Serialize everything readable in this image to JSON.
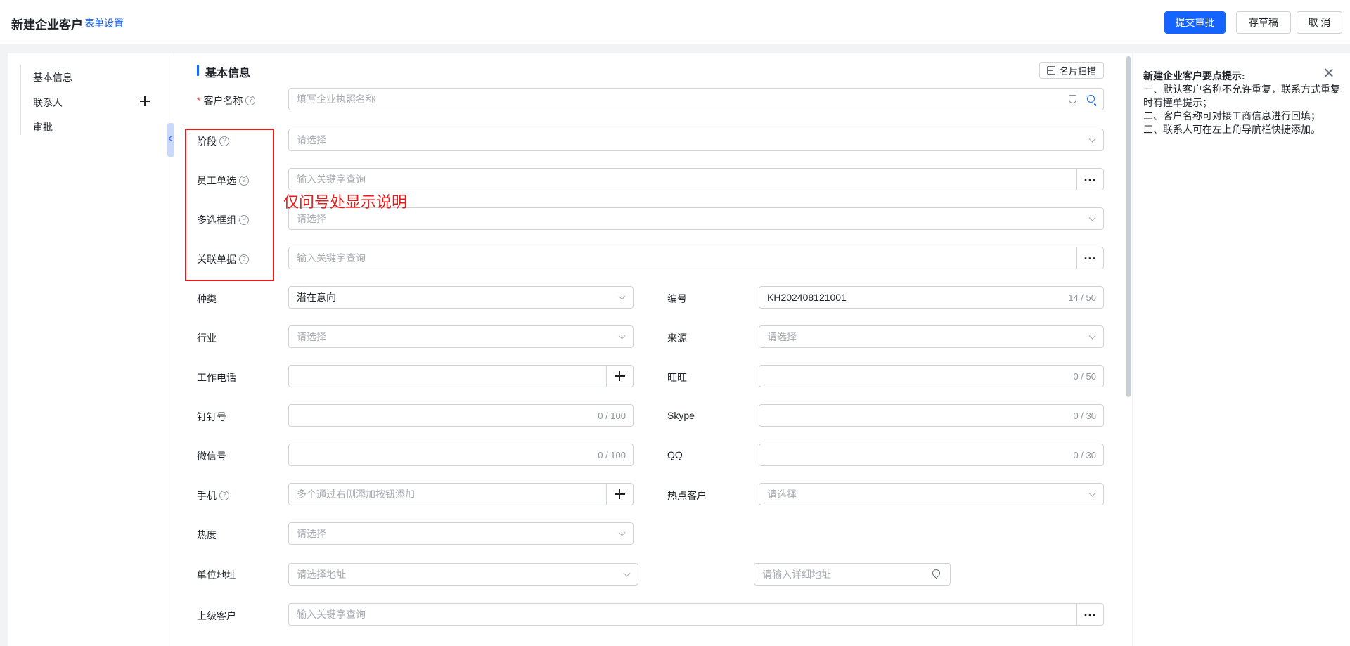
{
  "header": {
    "title": "新建企业客户",
    "form_settings": "表单设置",
    "submit": "提交审批",
    "draft": "存草稿",
    "cancel": "取 消"
  },
  "nav": {
    "items": [
      "基本信息",
      "联系人",
      "审批"
    ]
  },
  "section": {
    "title": "基本信息",
    "scan": "名片扫描"
  },
  "fields": {
    "customer_name": {
      "label": "客户名称",
      "placeholder": "填写企业执照名称"
    },
    "stage": {
      "label": "阶段",
      "placeholder": "请选择"
    },
    "employee": {
      "label": "员工单选",
      "placeholder": "输入关键字查询"
    },
    "multi": {
      "label": "多选框组",
      "placeholder": "请选择"
    },
    "related": {
      "label": "关联单据",
      "placeholder": "输入关键字查询"
    },
    "category": {
      "label": "种类",
      "value": "潜在意向"
    },
    "number": {
      "label": "编号",
      "value": "KH202408121001",
      "count": "14 / 50"
    },
    "industry": {
      "label": "行业",
      "placeholder": "请选择"
    },
    "source": {
      "label": "来源",
      "placeholder": "请选择"
    },
    "work_phone": {
      "label": "工作电话"
    },
    "wangwang": {
      "label": "旺旺",
      "count": "0 / 50"
    },
    "dingding": {
      "label": "钉钉号",
      "count": "0 / 100"
    },
    "skype": {
      "label": "Skype",
      "count": "0 / 30"
    },
    "wechat": {
      "label": "微信号",
      "count": "0 / 100"
    },
    "qq": {
      "label": "QQ",
      "count": "0 / 30"
    },
    "mobile": {
      "label": "手机",
      "placeholder": "多个通过右侧添加按钮添加"
    },
    "hot_customer": {
      "label": "热点客户",
      "placeholder": "请选择"
    },
    "heat": {
      "label": "热度",
      "placeholder": "请选择"
    },
    "address": {
      "label": "单位地址",
      "placeholder": "请选择地址",
      "detail_placeholder": "请输入详细地址"
    },
    "parent": {
      "label": "上级客户",
      "placeholder": "输入关键字查询"
    }
  },
  "annotation": "仅问号处显示说明",
  "tips": {
    "title": "新建企业客户要点提示:",
    "lines": [
      "一、默认客户名称不允许重复，联系方式重复时有撞单提示；",
      "二、客户名称可对接工商信息进行回填；",
      "三、联系人可在左上角导航栏快捷添加。"
    ]
  },
  "colors": {
    "primary": "#1664ff",
    "annotation": "#e81b1b",
    "required": "#f54a45"
  }
}
